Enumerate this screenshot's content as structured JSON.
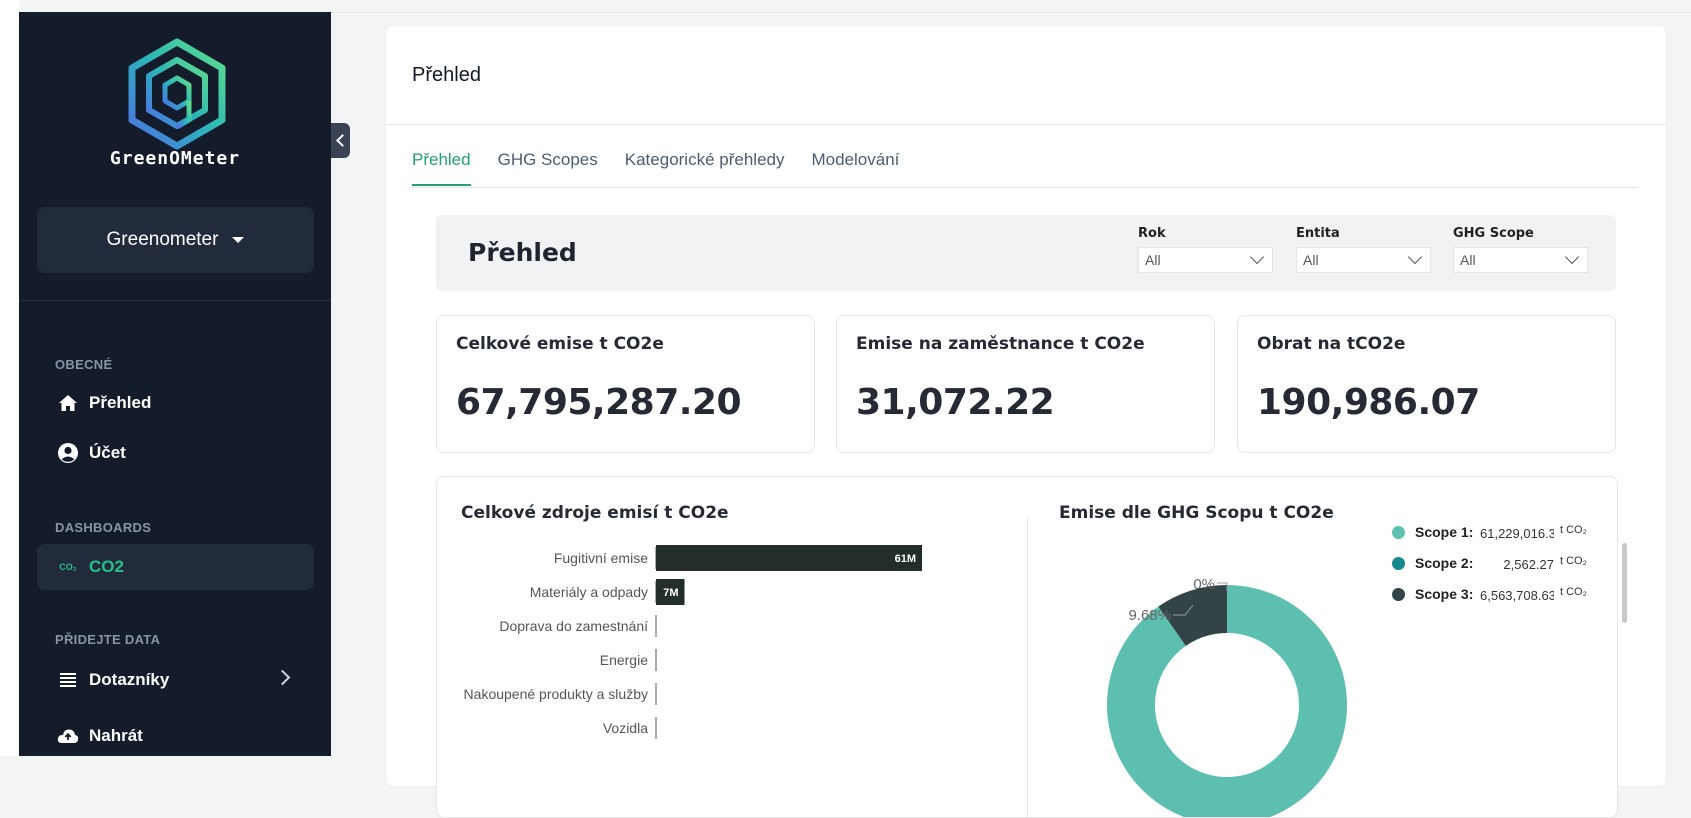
{
  "app": {
    "brand": "GreenOMeter",
    "org": "Greenometer"
  },
  "sidebar": {
    "sections": [
      {
        "label": "OBECNÉ"
      },
      {
        "label": "DASHBOARDS"
      },
      {
        "label": "PŘIDEJTE DATA"
      }
    ],
    "items": [
      {
        "label": "Přehled",
        "icon": "home-icon"
      },
      {
        "label": "Účet",
        "icon": "user-circle-icon"
      },
      {
        "label": "CO2",
        "icon": "co2-icon",
        "icon_text": "CO₂",
        "active": true
      },
      {
        "label": "Dotazníky",
        "icon": "list-icon"
      },
      {
        "label": "Nahrát",
        "icon": "cloud-upload-icon"
      }
    ]
  },
  "header": {
    "title": "Přehled"
  },
  "tabs": [
    {
      "label": "Přehled",
      "active": true
    },
    {
      "label": "GHG Scopes"
    },
    {
      "label": "Kategorické přehledy"
    },
    {
      "label": "Modelování"
    }
  ],
  "report": {
    "title": "Přehled",
    "filters": [
      {
        "label": "Rok",
        "value": "All"
      },
      {
        "label": "Entita",
        "value": "All"
      },
      {
        "label": "GHG Scope",
        "value": "All"
      }
    ],
    "kpis": [
      {
        "title": "Celkové emise t CO2e",
        "value": "67,795,287.20"
      },
      {
        "title": "Emise na zaměstnance t CO2e",
        "value": "31,072.22"
      },
      {
        "title": "Obrat na tCO2e",
        "value": "190,986.07"
      }
    ]
  },
  "chart_data": [
    {
      "type": "bar",
      "title": "Celkové zdroje emisí t CO2e",
      "orientation": "horizontal",
      "categories": [
        "Fugitivní emise",
        "Materiály a odpady",
        "Doprava do zamestnání",
        "Energie",
        "Nakoupené produkty a služby",
        "Vozidla"
      ],
      "values": [
        61229016.3,
        6563708.63,
        0,
        0,
        0,
        0
      ],
      "data_labels": [
        "61M",
        "7M",
        "",
        "",
        "",
        ""
      ],
      "color": "#232d29"
    },
    {
      "type": "pie",
      "title": "Emise dle GHG Scopu t CO2e",
      "donut": true,
      "labels": [
        "Scope 1:",
        "Scope 2:",
        "Scope 3:"
      ],
      "values": [
        61229016.3,
        2562.27,
        6563708.63
      ],
      "display_values": [
        "61,229,016.30",
        "2,562.27",
        "6,563,708.63"
      ],
      "unit": "t CO₂",
      "colors": [
        "#5cbfb0",
        "#16888f",
        "#334447"
      ],
      "annotations": [
        "9.68%",
        "0%"
      ]
    }
  ]
}
